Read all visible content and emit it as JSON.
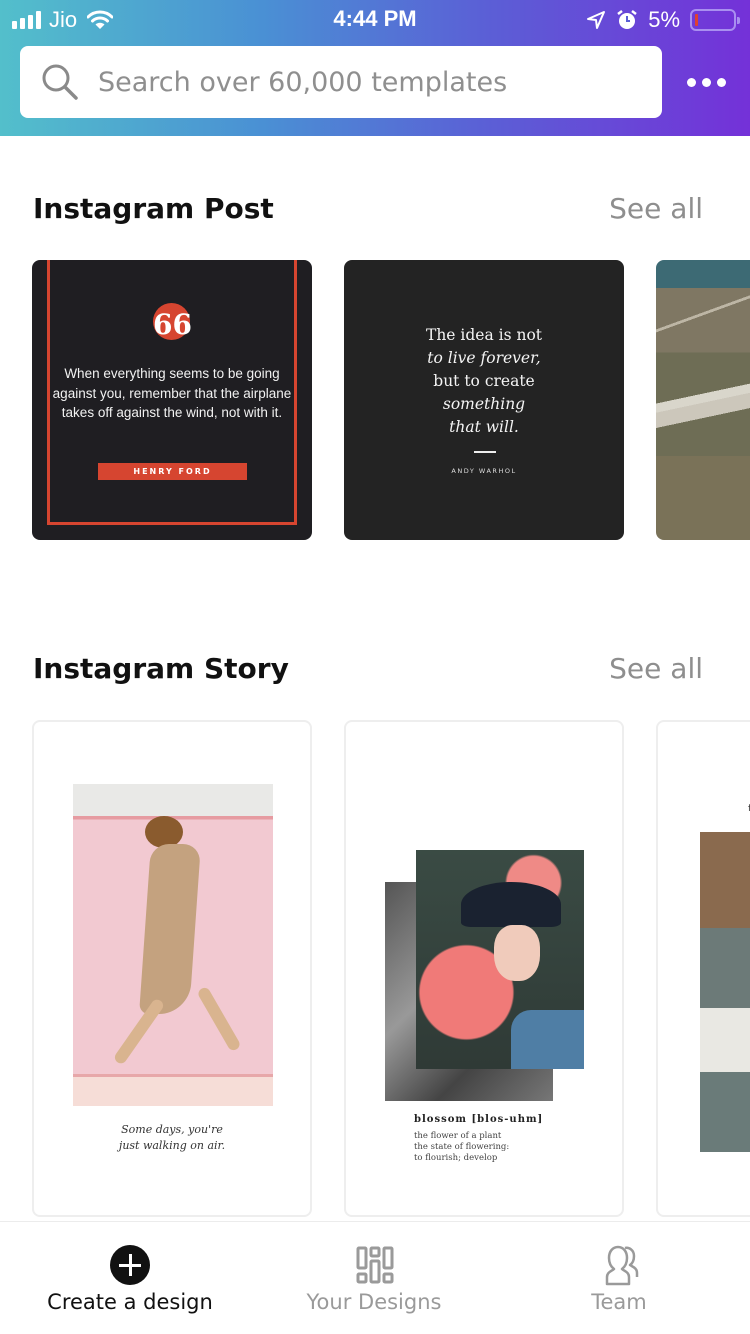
{
  "status_bar": {
    "carrier": "Jio",
    "time": "4:44 PM",
    "battery_percent": "5%",
    "battery_level": 0.05,
    "icons": [
      "signal-icon",
      "wifi-icon",
      "location-arrow-icon",
      "alarm-icon",
      "battery-icon"
    ]
  },
  "header": {
    "search_placeholder": "Search over 60,000 templates",
    "search_value": "",
    "more_button": "more-options"
  },
  "sections": [
    {
      "title": "Instagram Post",
      "see_all": "See all",
      "templates": [
        {
          "quote_mark": "66",
          "quote": "When everything seems to be going against you, remember that the airplane takes off against the wind, not with it.",
          "author": "HENRY FORD"
        },
        {
          "lines": [
            "The idea is not",
            "to live forever,",
            "but to create",
            "something",
            "that will."
          ],
          "author": "ANDY WARHOL"
        },
        {
          "description": "aerial landscape photo"
        }
      ]
    },
    {
      "title": "Instagram Story",
      "see_all": "See all",
      "templates": [
        {
          "caption_lines": [
            "Some days, you're",
            "just walking on air."
          ]
        },
        {
          "title": "blossom [blos-uhm]",
          "definition_lines": [
            "the flower of a plant",
            "the state of flowering:",
            "to flourish; develop"
          ]
        },
        {
          "partial_text": "f"
        }
      ]
    }
  ],
  "tab_bar": {
    "tabs": [
      {
        "label": "Create a design",
        "icon": "plus-circle-icon",
        "active": true
      },
      {
        "label": "Your Designs",
        "icon": "grid-icon",
        "active": false
      },
      {
        "label": "Team",
        "icon": "team-icon",
        "active": false
      }
    ]
  },
  "colors": {
    "gradient_start": "#53bfcb",
    "gradient_end": "#7431d8",
    "accent_red": "#d64530",
    "title_text": "#111111",
    "muted_text": "#8e8e8e"
  }
}
